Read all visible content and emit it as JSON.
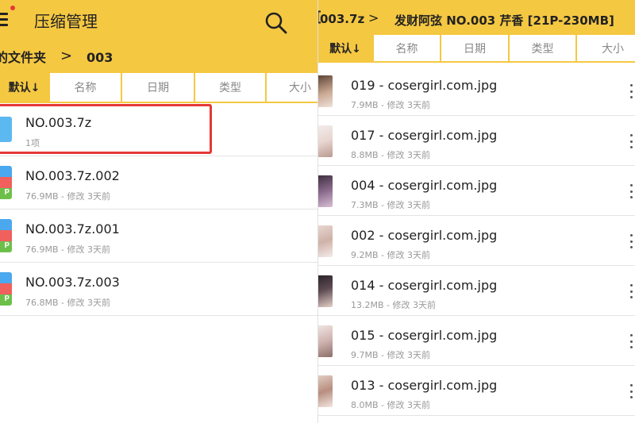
{
  "left": {
    "title": "压缩管理",
    "breadcrumb": {
      "parent": "的文件夹",
      "current": "003"
    },
    "sort_tabs": [
      "默认↓",
      "名称",
      "日期",
      "类型",
      "大小"
    ],
    "files": [
      {
        "name": "NO.003.7z",
        "meta": "1项",
        "icon": "folder-icon"
      },
      {
        "name": "NO.003.7z.002",
        "meta": "76.9MB - 修改 3天前",
        "icon": "zip-archive-icon"
      },
      {
        "name": "NO.003.7z.001",
        "meta": "76.9MB - 修改 3天前",
        "icon": "zip-archive-icon"
      },
      {
        "name": "NO.003.7z.003",
        "meta": "76.8MB - 修改 3天前",
        "icon": "zip-archive-icon"
      }
    ]
  },
  "right": {
    "breadcrumb": {
      "parent": "003.7z",
      "current": "发财阿弦 NO.003 芹香 [21P-230MB]"
    },
    "sort_tabs": [
      "默认↓",
      "名称",
      "日期",
      "类型",
      "大小"
    ],
    "files": [
      {
        "name": "019 - cosergirl.com.jpg",
        "meta": "7.9MB - 修改 3天前"
      },
      {
        "name": "017 - cosergirl.com.jpg",
        "meta": "8.8MB - 修改 3天前"
      },
      {
        "name": "004 - cosergirl.com.jpg",
        "meta": "7.3MB - 修改 3天前"
      },
      {
        "name": "002 - cosergirl.com.jpg",
        "meta": "9.2MB - 修改 3天前"
      },
      {
        "name": "014 - cosergirl.com.jpg",
        "meta": "13.2MB - 修改 3天前"
      },
      {
        "name": "015 - cosergirl.com.jpg",
        "meta": "9.7MB - 修改 3天前"
      },
      {
        "name": "013 - cosergirl.com.jpg",
        "meta": "8.0MB - 修改 3天前"
      }
    ]
  },
  "colors": {
    "accent": "#f5c842",
    "highlight": "#e53935",
    "folder": "#5cb8f0"
  },
  "icons": {
    "menu": "menu-icon",
    "search": "search-icon",
    "more": "more-vert-icon"
  }
}
